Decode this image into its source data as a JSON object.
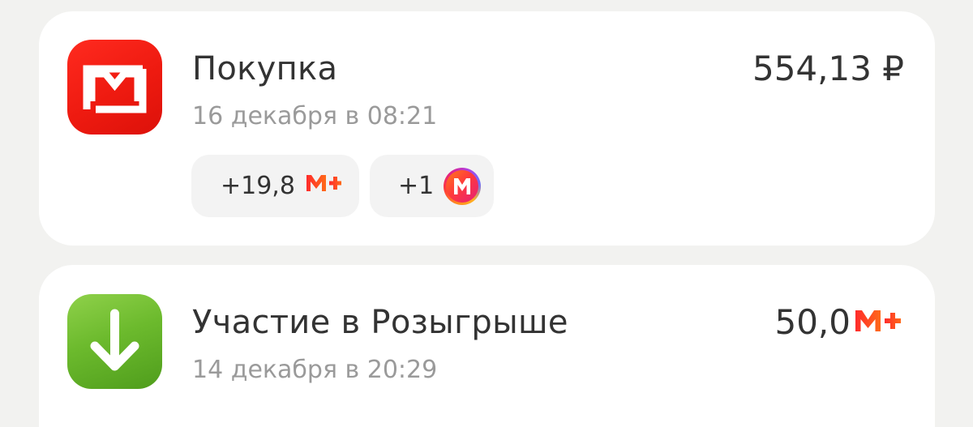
{
  "transactions": [
    {
      "title": "Покупка",
      "date": "16 декабря в 08:21",
      "amount": "554,13 ₽",
      "icon": "magnit-logo-icon",
      "icon_color": "#ee1a10",
      "rewards": [
        {
          "value": "+19,8",
          "icon": "m-plus-icon"
        },
        {
          "value": "+1",
          "icon": "m-coin-icon"
        }
      ]
    },
    {
      "title": "Участие в Розыгрыше",
      "date": "14 декабря в 20:29",
      "amount": "50,0",
      "amount_icon": "m-plus-icon",
      "icon": "arrow-down-icon",
      "icon_color": "#6cba2d"
    }
  ],
  "colors": {
    "background": "#f2f2f0",
    "card": "#ffffff",
    "text_primary": "#333333",
    "text_secondary": "#9a9a9a",
    "mplus_gradient": [
      "#ff2b2b",
      "#ff6a1a"
    ]
  }
}
